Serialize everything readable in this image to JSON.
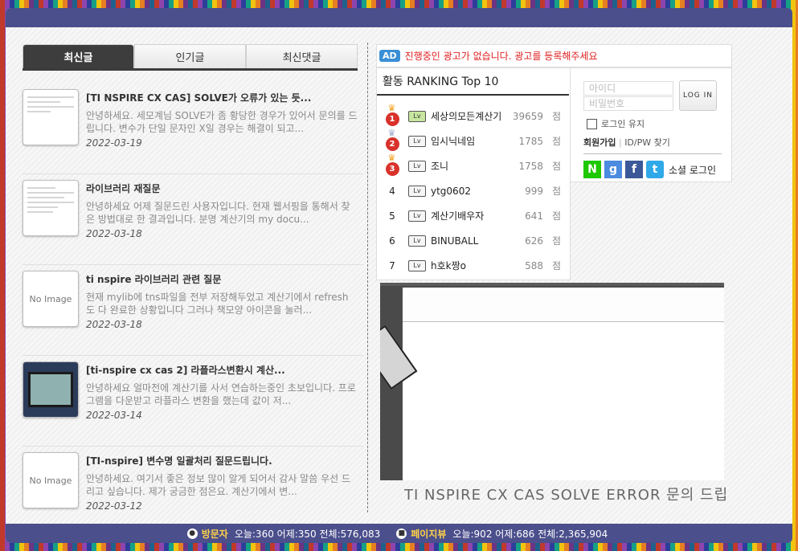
{
  "tabs": [
    "최신글",
    "인기글",
    "최신댓글"
  ],
  "posts": [
    {
      "title": "[TI NSPIRE CX CAS] SOLVE가 오류가 있는 듯...",
      "desc": "안녕하세요. 세모계님 SOLVE가 좀 황당한 경우가 있어서 문의를 드립니다. 변수가 단일 문자인 X일 경우는 해결이 되고...",
      "date": "2022-03-19"
    },
    {
      "title": "라이브러리 재질문",
      "desc": "안녕하세요 어제 질문드린 사용자입니다. 현재 웹서핑을 통해서 찾은 방법대로 한 결과입니다. 분명 계산기의 my docu...",
      "date": "2022-03-18"
    },
    {
      "title": "ti nspire 라이브러리 관련 질문",
      "desc": "현재 mylib에 tns파일을 전부 저장해두었고 계산기에서 refresh 도 다 완료한 상황입니다 그러나 책모양 아이콘을 눌러...",
      "date": "2022-03-18",
      "thumb": "No Image"
    },
    {
      "title": "[ti-nspire cx cas 2] 라플라스변환시 계산...",
      "desc": "안녕하세요 얼마전에 계산기를 사서 연습하는중인 초보입니다. 프로그램을 다운받고 라플라스 변환을 했는데 값이 저...",
      "date": "2022-03-14"
    },
    {
      "title": "[TI-nspire] 변수명 일괄처리 질문드립니다.",
      "desc": "안녕하세요. 여기서 좋은 정보 많이 알게 되어서 감사 말씀 우선 드리고 싶습니다. 제가 궁금한 점은요. 계산기에서 변...",
      "date": "2022-03-12",
      "thumb": "No Image"
    }
  ],
  "ad": {
    "badge": "AD",
    "text": "진행중인 광고가 없습니다. 광고를 등록해주세요"
  },
  "ranking": {
    "title": "활동 RANKING Top 10",
    "unit": "점",
    "items": [
      {
        "rank": "1",
        "name": "세상의모든계산기",
        "score": "39659"
      },
      {
        "rank": "2",
        "name": "임시닉네임",
        "score": "1785"
      },
      {
        "rank": "3",
        "name": "조니",
        "score": "1758"
      },
      {
        "rank": "4",
        "name": "ytg0602",
        "score": "999"
      },
      {
        "rank": "5",
        "name": "계산기배우자",
        "score": "641"
      },
      {
        "rank": "6",
        "name": "BINUBALL",
        "score": "626"
      },
      {
        "rank": "7",
        "name": "h호k짱o",
        "score": "588"
      }
    ]
  },
  "login": {
    "id_placeholder": "아이디",
    "pw_placeholder": "비밀번호",
    "button": "LOG IN",
    "keep": "로그인 유지",
    "join": "회원가입",
    "find": "ID/PW 찾기",
    "social_label": "소셜 로그인"
  },
  "feature": {
    "caption": "TI NSPIRE CX CAS SOLVE ERROR 문의 드립니다"
  },
  "footer": {
    "visitors_label": "방문자",
    "visitors": "오늘:360  어제:350  전체:576,083",
    "pageviews_label": "페이지뷰",
    "pageviews": "오늘:902  어제:686  전체:2,365,904"
  }
}
